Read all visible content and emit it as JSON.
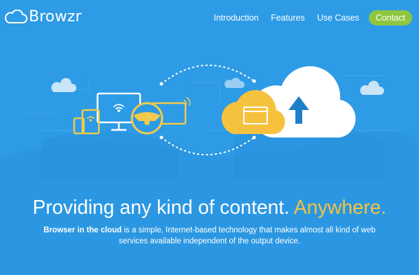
{
  "brand": {
    "name": "Browzr"
  },
  "nav": {
    "items": [
      "Introduction",
      "Features",
      "Use Cases"
    ],
    "cta": "Contact"
  },
  "hero": {
    "headline_main": "Providing any kind of content. ",
    "headline_accent": "Anywhere.",
    "subtext_bold": "Browser in the cloud",
    "subtext_rest": " is a simple, Internet-based technology that makes almost all kind of web services available independent of the output device."
  },
  "colors": {
    "background": "#2d9be6",
    "accent_yellow": "#f6c23e",
    "cta_green": "#8ec63f",
    "device_line": "#f2c94c",
    "cloud_white": "#ffffff"
  },
  "icons": [
    "cloud-logo-icon",
    "wifi-icon",
    "steering-wheel-icon",
    "upload-arrow-icon",
    "browser-window-icon"
  ]
}
